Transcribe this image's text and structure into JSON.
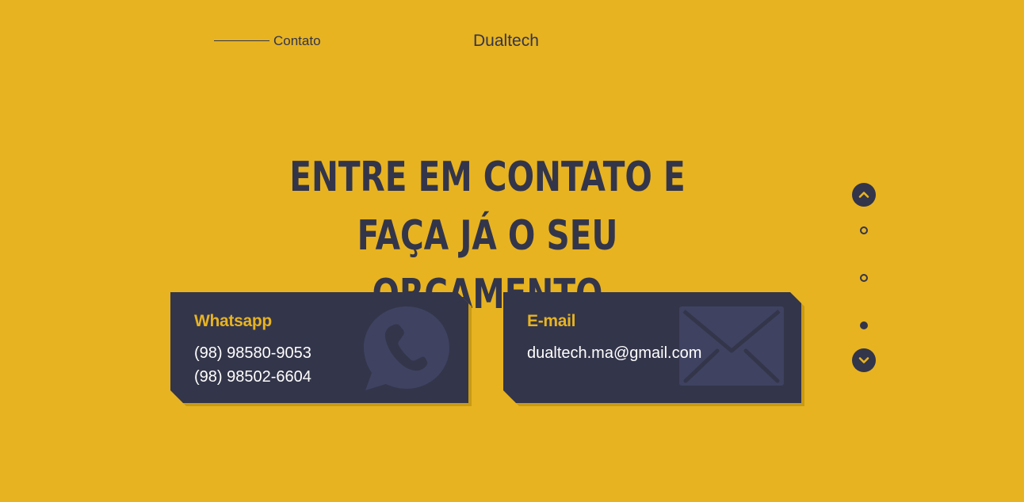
{
  "header": {
    "section_label": "Contato",
    "brand": "Dualtech"
  },
  "main": {
    "heading": "Entre em contato e faça já o seu orçamento"
  },
  "cards": {
    "whatsapp": {
      "title": "Whatsapp",
      "phones": [
        "(98) 98580-9053",
        "(98) 98502-6604"
      ],
      "icon": "whatsapp-icon"
    },
    "email": {
      "title": "E-mail",
      "address": "dualtech.ma@gmail.com",
      "icon": "envelope-icon"
    }
  },
  "side_nav": {
    "up_icon": "chevron-up-icon",
    "down_icon": "chevron-down-icon",
    "dots": 3,
    "active_dot": 3
  },
  "colors": {
    "background": "#E7B321",
    "dark": "#33354A",
    "accent": "#E7B321",
    "text_light": "#FFFFFF",
    "icon_tint": "#3F4260"
  }
}
